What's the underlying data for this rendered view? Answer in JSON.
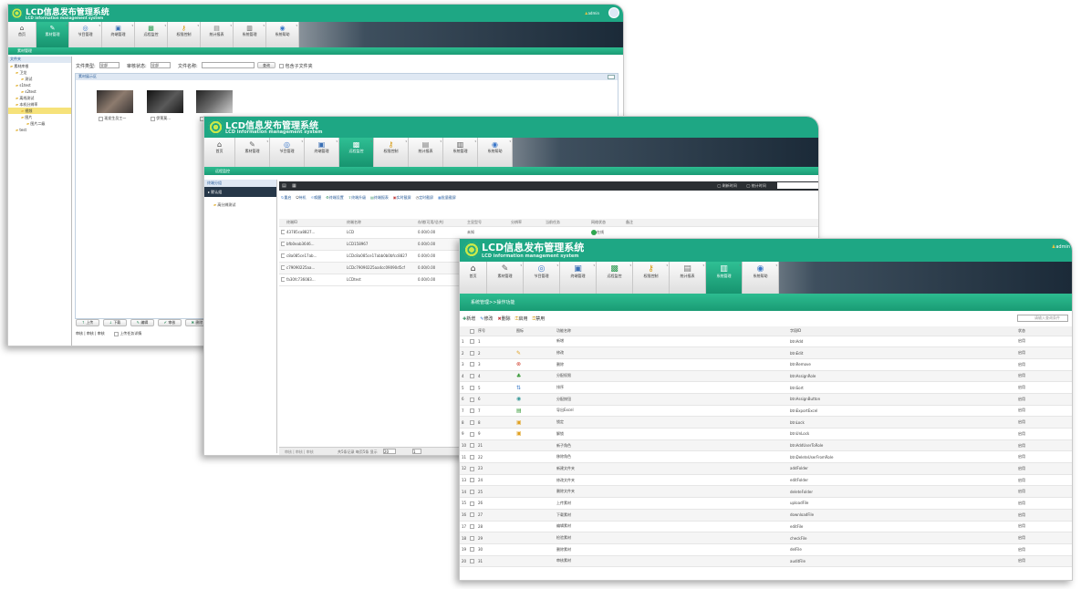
{
  "app": {
    "title": "LCD信息发布管理系统",
    "subtitle": "LCD information management system",
    "user": "admin"
  },
  "nav": [
    {
      "label": "首页",
      "icon": "home-icon",
      "glyph": "⌂",
      "color": "#444"
    },
    {
      "label": "素材管理",
      "icon": "pencil-icon",
      "glyph": "✎",
      "color": "#666"
    },
    {
      "label": "节目管理",
      "icon": "globe-icon",
      "glyph": "◎",
      "color": "#3a77c9"
    },
    {
      "label": "终端管理",
      "icon": "monitor-icon",
      "glyph": "▣",
      "color": "#3a6fb5"
    },
    {
      "label": "远程监控",
      "icon": "monitor-green-icon",
      "glyph": "▩",
      "color": "#2c9a52"
    },
    {
      "label": "权限控制",
      "icon": "key-icon",
      "glyph": "⚷",
      "color": "#d79a11"
    },
    {
      "label": "统计报表",
      "icon": "report-icon",
      "glyph": "▤",
      "color": "#777"
    },
    {
      "label": "系统管理",
      "icon": "system-icon",
      "glyph": "▥",
      "color": "#555"
    },
    {
      "label": "系统帮助",
      "icon": "help-icon",
      "glyph": "◉",
      "color": "#3a77c9"
    }
  ],
  "w1": {
    "breadcrumb": "素材管理",
    "tree_title": "文件夹",
    "tree": [
      "素材库根",
      "卫龙",
      "测试",
      "s1test",
      "s2test",
      "离线测试",
      "本机分辨率",
      "视频",
      "图片",
      "图片二级",
      "test"
    ],
    "filter": {
      "type_label": "文件类型:",
      "type_value": "全部",
      "audit_label": "审核状态:",
      "audit_value": "全部",
      "name_label": "文件名称:",
      "search_btn": "查询",
      "include_sub": "包含子文件夹"
    },
    "preview_title": "素材展示区",
    "thumbs": [
      "现发生员工一",
      "伊莱莫...",
      "傅仙鉴"
    ],
    "buttons": [
      "上传",
      "下载",
      "编辑",
      "审核",
      "删除"
    ],
    "status": "审核 | 审核 | 审核",
    "status2": "上传任务详情"
  },
  "w2": {
    "breadcrumb": "远程监控",
    "side_title": "终端分组",
    "group": "默认组",
    "terminal": "高分辨测试",
    "times": [
      "刷新时间",
      "统计时间"
    ],
    "toolbar": [
      "重启",
      "待机",
      "唤醒",
      "终端设置",
      "终端升级",
      "终端报表",
      "实时截屏",
      "定时截屏",
      "批量截屏"
    ],
    "headers": [
      "终端ID",
      "终端名称",
      "存储(可用/总共)",
      "主显型号",
      "分辨率",
      "当前任务",
      "网络状态",
      "备注"
    ],
    "rows": [
      {
        "id": "43785ca8827...",
        "name": "LCD",
        "storage": "0.00/0.00",
        "model": "未知",
        "online": true,
        "state": "在线"
      },
      {
        "id": "bfb0eab3646...",
        "name": "LCD158967",
        "storage": "0.00/0.00",
        "model": "未知",
        "online": false,
        "state": "离线"
      },
      {
        "id": "c8a085ce17ab...",
        "name": "LCDc8a085ce17abb0b0bfcc8827",
        "storage": "0.00/0.00",
        "model": "",
        "online": false,
        "state": ""
      },
      {
        "id": "c79090225aa...",
        "name": "LCDc79090225aa4cc09090d5cf",
        "storage": "0.00/0.00",
        "model": "",
        "online": false,
        "state": ""
      },
      {
        "id": "fa30fc736083...",
        "name": "LCDtest",
        "storage": "0.00/0.00",
        "model": "",
        "online": false,
        "state": ""
      }
    ],
    "pager": "共5条记录 每页5条 显示",
    "pager_size": "20",
    "pager_page": "1"
  },
  "w3": {
    "breadcrumb": "系统管理>>操作功能",
    "search_placeholder": "请输入查询条件",
    "toolbar": [
      "新增",
      "修改",
      "删除",
      "启用",
      "禁用"
    ],
    "headers": [
      "序号",
      "",
      "图标",
      "功能名称",
      "字段ID",
      "状态"
    ],
    "rows": [
      {
        "n": "1",
        "seq": "1",
        "icon": "",
        "name": "新增",
        "code": "btnAdd",
        "state": "启用"
      },
      {
        "n": "2",
        "seq": "2",
        "icon": "✎",
        "ic": "#e0a020",
        "name": "修改",
        "code": "btnEdit",
        "state": "启用"
      },
      {
        "n": "3",
        "seq": "3",
        "icon": "⊗",
        "ic": "#d04030",
        "name": "删除",
        "code": "btnRemove",
        "state": "启用"
      },
      {
        "n": "4",
        "seq": "4",
        "icon": "♣",
        "ic": "#3a9a3a",
        "name": "分配权限",
        "code": "btnAssignRole",
        "state": "启用"
      },
      {
        "n": "5",
        "seq": "5",
        "icon": "⇅",
        "ic": "#3a7ac9",
        "name": "排序",
        "code": "btnSort",
        "state": "启用"
      },
      {
        "n": "6",
        "seq": "6",
        "icon": "◉",
        "ic": "#3a9a9a",
        "name": "分配按钮",
        "code": "btnAssignButton",
        "state": "启用"
      },
      {
        "n": "7",
        "seq": "7",
        "icon": "▤",
        "ic": "#3a9a3a",
        "name": "导出Excel",
        "code": "btnExportExcel",
        "state": "启用"
      },
      {
        "n": "8",
        "seq": "8",
        "icon": "▣",
        "ic": "#e0a020",
        "name": "锁定",
        "code": "btnLock",
        "state": "启用"
      },
      {
        "n": "9",
        "seq": "9",
        "icon": "▣",
        "ic": "#e0a020",
        "name": "解锁",
        "code": "btnUnLock",
        "state": "启用"
      },
      {
        "n": "10",
        "seq": "21",
        "icon": "",
        "name": "新子角色",
        "code": "btnAddUserToRole",
        "state": "启用"
      },
      {
        "n": "11",
        "seq": "22",
        "icon": "",
        "name": "移除角色",
        "code": "btnDeleteUserFromRole",
        "state": "启用"
      },
      {
        "n": "12",
        "seq": "23",
        "icon": "",
        "name": "新建文件夹",
        "code": "addFolder",
        "state": "启用"
      },
      {
        "n": "13",
        "seq": "24",
        "icon": "",
        "name": "修改文件夹",
        "code": "editFolder",
        "state": "启用"
      },
      {
        "n": "14",
        "seq": "25",
        "icon": "",
        "name": "删除文件夹",
        "code": "deleteFolder",
        "state": "启用"
      },
      {
        "n": "15",
        "seq": "26",
        "icon": "",
        "name": "上传素材",
        "code": "uploadFile",
        "state": "启用"
      },
      {
        "n": "16",
        "seq": "27",
        "icon": "",
        "name": "下载素材",
        "code": "downloadFile",
        "state": "启用"
      },
      {
        "n": "17",
        "seq": "28",
        "icon": "",
        "name": "编辑素材",
        "code": "editFile",
        "state": "启用"
      },
      {
        "n": "18",
        "seq": "29",
        "icon": "",
        "name": "检验素材",
        "code": "checkFile",
        "state": "启用"
      },
      {
        "n": "19",
        "seq": "30",
        "icon": "",
        "name": "删除素材",
        "code": "delFile",
        "state": "启用"
      },
      {
        "n": "20",
        "seq": "31",
        "icon": "",
        "name": "审核素材",
        "code": "auditFile",
        "state": "启用"
      }
    ]
  }
}
